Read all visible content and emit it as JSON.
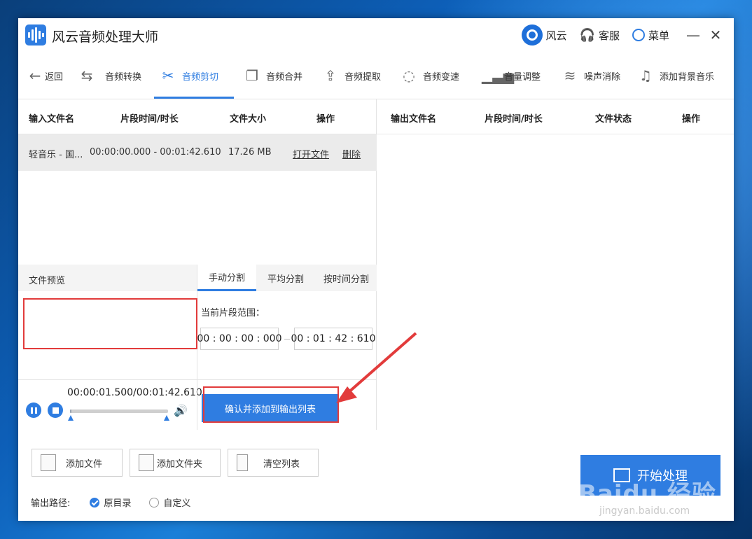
{
  "app": {
    "title": "风云音频处理大师"
  },
  "titlebar": {
    "user_label": "风云",
    "service_label": "客服",
    "menu_label": "菜单",
    "minimize": "—",
    "close": "✕"
  },
  "toolbar": {
    "back": "返回",
    "items": [
      {
        "label": "音频转换",
        "icon": "convert-icon"
      },
      {
        "label": "音频剪切",
        "icon": "scissors-icon"
      },
      {
        "label": "音频合并",
        "icon": "merge-icon"
      },
      {
        "label": "音频提取",
        "icon": "extract-icon"
      },
      {
        "label": "音频变速",
        "icon": "speed-icon"
      },
      {
        "label": "音量调整",
        "icon": "volume-bars-icon"
      },
      {
        "label": "噪声消除",
        "icon": "noise-icon"
      },
      {
        "label": "添加背景音乐",
        "icon": "music-note-icon"
      }
    ],
    "active": "音频剪切"
  },
  "input_table": {
    "headers": [
      "输入文件名",
      "片段时间/时长",
      "文件大小",
      "操作"
    ],
    "rows": [
      {
        "name": "轻音乐 - 国...",
        "segment": "00:00:00.000 - 00:01:42.610",
        "size": "17.26 MB",
        "open": "打开文件",
        "delete": "删除"
      }
    ]
  },
  "output_table": {
    "headers": [
      "输出文件名",
      "片段时间/时长",
      "文件状态",
      "操作"
    ]
  },
  "preview": {
    "title": "文件预览",
    "time": "00:00:01.500/00:01:42.610",
    "progress": 0.015
  },
  "split": {
    "tabs": [
      "手动分割",
      "平均分割",
      "按时间分割"
    ],
    "active": "手动分割",
    "range_label": "当前片段范围：",
    "start": "00 : 00 : 00 : 000",
    "end": "00 : 01 : 42 : 610",
    "confirm": "确认并添加到输出列表"
  },
  "bottom": {
    "add_file": "添加文件",
    "add_folder": "添加文件夹",
    "clear": "清空列表",
    "output_path_label": "输出路径:",
    "option_original": "原目录",
    "option_custom": "自定义",
    "start": "开始处理"
  },
  "watermark": {
    "brand": "Baidu 经验",
    "url": "jingyan.baidu.com"
  },
  "colors": {
    "accent": "#2f7de1",
    "highlight_box": "#e23b3b",
    "wave_start": "#3fc06a",
    "wave_end": "#c8e21a"
  }
}
